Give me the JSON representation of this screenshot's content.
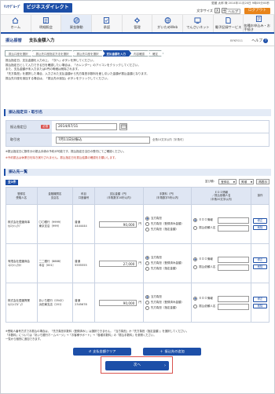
{
  "header": {
    "brand_prefix": "ﾘｿﾅｸﾞﾙｰﾌﾟ",
    "brand": "ビジネスダイレクト",
    "user_line": "愛媛 太郎 様 2014年11月20日 9時05分00秒",
    "text_size_label": "文字サイズ",
    "text_size_large": "大",
    "text_size_medium": "中",
    "help_label": "ヘルプ",
    "logout_label": "ログアウト"
  },
  "nav": [
    {
      "label": "ホーム",
      "icon": "home-icon"
    },
    {
      "label": "明細照会",
      "icon": "list-icon"
    },
    {
      "label": "資金移動",
      "icon": "transfer-icon"
    },
    {
      "label": "承認",
      "icon": "approve-icon"
    },
    {
      "label": "管理",
      "icon": "gear-icon"
    },
    {
      "label": "がいためWeb",
      "icon": "globe-icon"
    },
    {
      "label": "でんさいネット",
      "icon": "network-icon"
    },
    {
      "label": "電子記録サービス",
      "icon": "document-icon"
    },
    {
      "label": "各種お申込み・お手続き",
      "icon": "form-icon"
    }
  ],
  "page": {
    "category": "振込振替",
    "title": "支払金額入力",
    "code": "BFKF011",
    "help": "ヘルプ"
  },
  "steps": [
    "振込口座を選択",
    "振込先口座指定方法を選択",
    "振込先口座を選択",
    "支払金額を入力",
    "内容確認",
    "確定"
  ],
  "active_step": 3,
  "instructions": [
    "振込指定日、支払金額を入力の上、「次へ」ボタンを押してください。",
    "振込指定日として入力できる日を確認したい場合は、「カレンダー」のアイコンをクリックしてください。",
    "また、支払金額が未入力または0円の明細は削除されます。",
    "「先方負担」を選択した場合、入力された支払金額から先方負担手数料を差し引いた金額が振込金額となります。",
    "振込先口座を追加する場合は、「振込先の追加」ボタンをクリックしてください。"
  ],
  "transfer_section": {
    "title": "振込指定日・取引名",
    "date_label": "振込指定日",
    "required": "必須",
    "date_value": "2014/07/11",
    "calendar_icon": "calendar-icon",
    "name_label": "取引名",
    "name_value": "7月11日分振込",
    "name_hint": "全角10文字以内［半角可］"
  },
  "note1": "※振込指定日に数件分の振込手続の予約が可能です。振込指定日当日の受付にてご確認ください。",
  "note2": "※予約振込は休業日を除き実行されません。振込指定日を振込結果の確認をお願いします。",
  "payee_section": {
    "title": "振込先一覧",
    "all_label": "全3件",
    "sort_label": "並び順：",
    "sort_value": "登録名",
    "order_value": "昇順",
    "sort_button": "再表示",
    "headers": [
      "登録名\n受取人名",
      "金融機関名\n支店名",
      "科目\n口座番号",
      "支払金額（円）\n（半角数字10桁以内）",
      "手数料（円）\n（半角数字5桁以内）",
      "ＥＤＩ情報\n／振込依頼人名\n（半角20文字以内）",
      "操作"
    ],
    "rows": [
      {
        "name": "株式会社愛媛商事\nｶ)ｴﾋﾒｼｮｳｼﾞ",
        "bank": "〇〇銀行（9999）\n東京支店（999）",
        "account": "普通\n4444444",
        "amount": "90,000",
        "fee_options": [
          "当方負担",
          "先方負担（登録済み金額）",
          "先方負担（指定金額）"
        ],
        "edi_options": [
          "ＥＤＩ情報",
          "振込依頼人名"
        ]
      },
      {
        "name": "有限会社愛媛商会\nﾕ)ｴﾋﾒｼｮｳｶｲ",
        "bank": "二二銀行（8888）\n本店（001）",
        "account": "普通\n5555555",
        "amount": "27,000",
        "fee_options": [
          "当方負担",
          "先方負担（登録済み金額）",
          "先方負担（指定金額）"
        ],
        "edi_options": [
          "ＥＤＩ情報",
          "振込依頼人名"
        ]
      },
      {
        "name": "株式会社愛媛興業\nｶ)ｴﾋﾒｺｳｷﾞｮｳ",
        "bank": "あいち銀行（0542）\n浜田東支店（201）",
        "account": "普通\n2345678",
        "amount": "90,000",
        "fee_options": [
          "当方負担",
          "先方負担（登録済み金額）",
          "先方負担（指定金額）"
        ],
        "edi_options": [
          "ＥＤＩ情報",
          "振込依頼人名"
        ]
      }
    ],
    "row_btn_edit": "修正",
    "row_btn_delete": "削除"
  },
  "bottom_note": [
    "※受取人番号方式でお振込の場合は、「先方負担手数料（登録済み）」は選択できません。「当方負担」か「先方負担（指定金額）」を選択してください。",
    "「手数料」については「あいち銀行ホームページ」→「お客様サポート」→「各種手数料」の「振込手数料」を参照ください。",
    "一覧から個別に追加できます。"
  ],
  "buttons": {
    "clear": "支払金額クリア",
    "add": "振込先の追加",
    "next": "次へ"
  }
}
